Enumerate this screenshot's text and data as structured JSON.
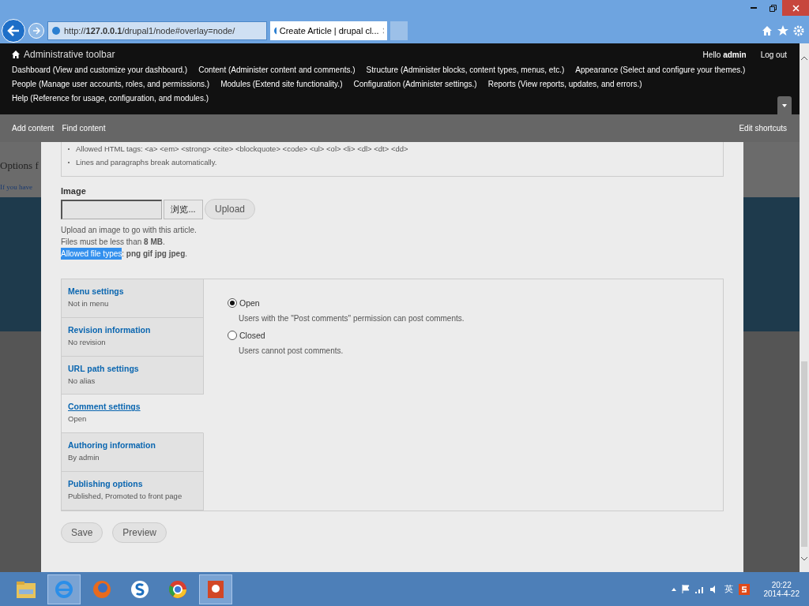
{
  "browser": {
    "url": "http://**127.0.0.1**/drupal1/node#overlay=node/",
    "tab_title": "Create Article | drupal cl..."
  },
  "toolbar": {
    "title": "Administrative toolbar",
    "greeting": "Hello **admin**",
    "logout": "Log out",
    "menu": [
      [
        "Dashboard (View and customize your dashboard.)",
        "Content (Administer content and comments.)",
        "Structure (Administer blocks, content types, menus, etc.)",
        "Appearance (Select and configure your themes.)"
      ],
      [
        "People (Manage user accounts, roles, and permissions.)",
        "Modules (Extend site functionality.)",
        "Configuration (Administer settings.)",
        "Reports (View reports, updates, and errors.)"
      ],
      [
        "Help (Reference for usage, configuration, and modules.)"
      ]
    ],
    "shortcuts": [
      "Add content",
      "Find content"
    ],
    "edit_shortcuts": "Edit shortcuts"
  },
  "background": {
    "heading": "Options f",
    "text": "If you have"
  },
  "form": {
    "filter_tips": [
      "Allowed HTML tags: <a> <em> <strong> <cite> <blockquote> <code> <ul> <ol> <li> <dl> <dt> <dd>",
      "Lines and paragraphs break automatically."
    ],
    "image": {
      "label": "Image",
      "browse_button": "浏览...",
      "upload_button": "Upload",
      "help": [
        "Upload an image to go with this article.",
        "Files must be less than **8 MB**."
      ],
      "types_selected_text": "Allowed file types",
      "types_rest": ": **png gif jpg jpeg**."
    },
    "vertical_tabs": [
      {
        "title": "Menu settings",
        "summary": "Not in menu",
        "selected": false
      },
      {
        "title": "Revision information",
        "summary": "No revision",
        "selected": false
      },
      {
        "title": "URL path settings",
        "summary": "No alias",
        "selected": false
      },
      {
        "title": "Comment settings",
        "summary": "Open",
        "selected": true
      },
      {
        "title": "Authoring information",
        "summary": "By admin",
        "selected": false
      },
      {
        "title": "Publishing options",
        "summary": "Published, Promoted to front page",
        "selected": false
      }
    ],
    "comment_options": [
      {
        "label": "Open",
        "description": "Users with the \"Post comments\" permission can post comments.",
        "selected": true
      },
      {
        "label": "Closed",
        "description": "Users cannot post comments.",
        "selected": false
      }
    ],
    "buttons": [
      "Save",
      "Preview"
    ]
  },
  "taskbar": {
    "apps": [
      {
        "kind": "folder",
        "active": false
      },
      {
        "kind": "ie",
        "active": true
      },
      {
        "kind": "firefox",
        "active": false
      },
      {
        "kind": "s",
        "active": false
      },
      {
        "kind": "chrome",
        "active": false
      },
      {
        "kind": "powerpoint",
        "active": true
      }
    ],
    "ime": "英",
    "time": "20:22",
    "date": "2014-4-22"
  }
}
